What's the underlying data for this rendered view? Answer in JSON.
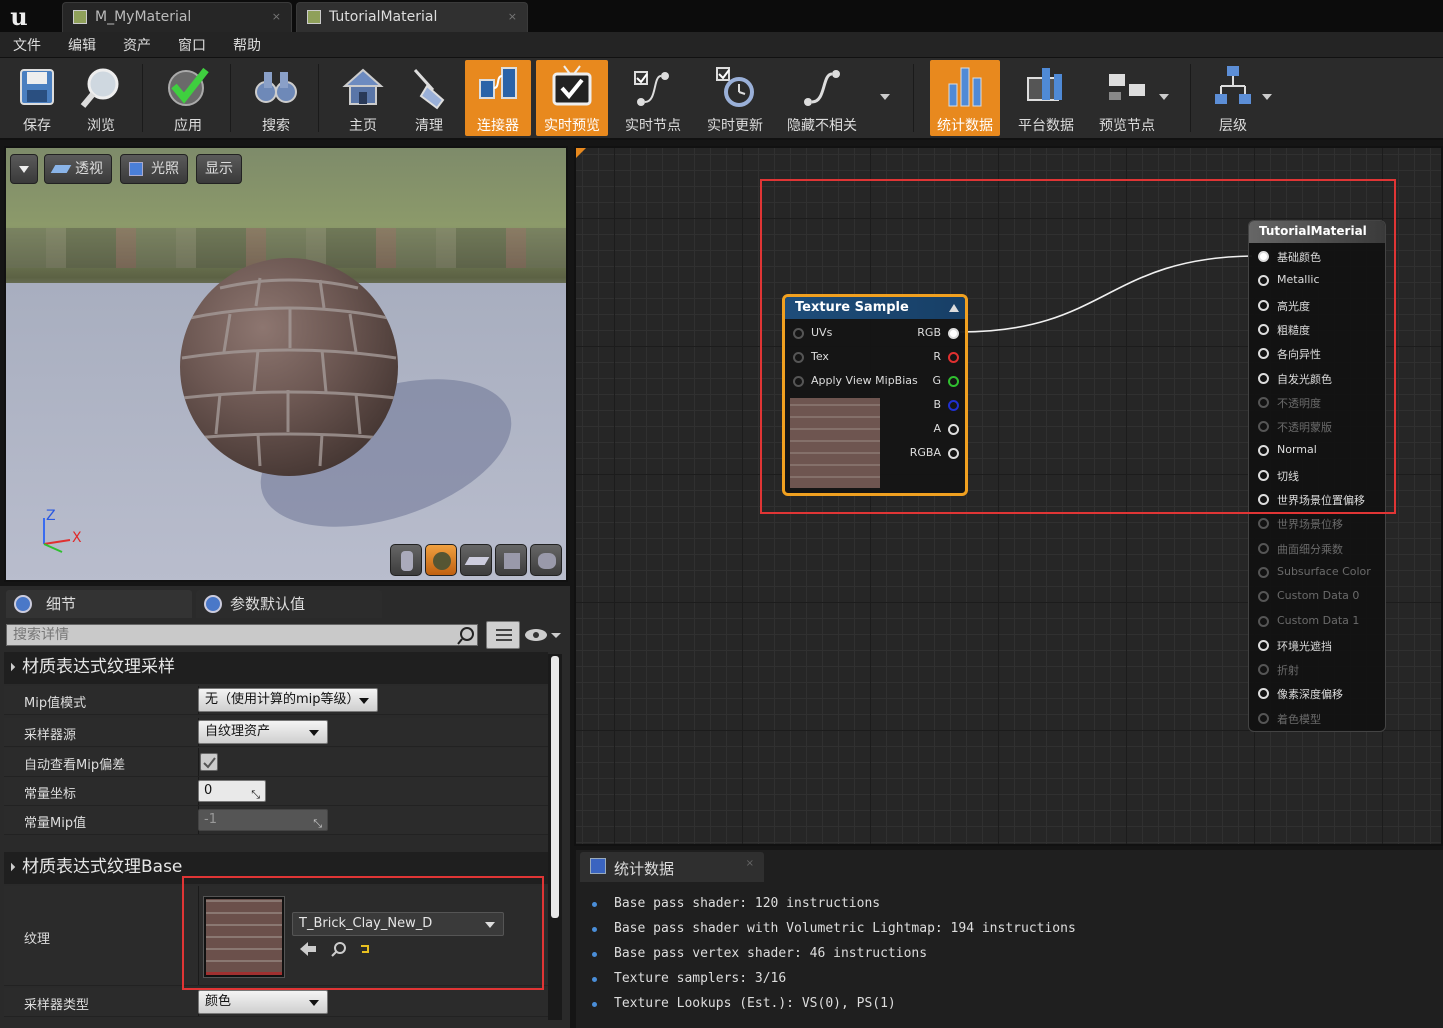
{
  "tabs": [
    {
      "label": "M_MyMaterial",
      "close": "×"
    },
    {
      "label": "TutorialMaterial",
      "close": "×"
    }
  ],
  "menu": [
    "文件",
    "编辑",
    "资产",
    "窗口",
    "帮助"
  ],
  "toolbar": {
    "save": "保存",
    "browse": "浏览",
    "apply": "应用",
    "search": "搜索",
    "home": "主页",
    "clean": "清理",
    "connectors": "连接器",
    "live_preview": "实时预览",
    "live_nodes": "实时节点",
    "live_update": "实时更新",
    "hide_unrelated": "隐藏不相关",
    "stats": "统计数据",
    "platform_stats": "平台数据",
    "preview_nodes": "预览节点",
    "hierarchy": "层级"
  },
  "viewport": {
    "perspective": "透视",
    "lit": "光照",
    "show": "显示",
    "axis_z": "Z",
    "axis_x": "X"
  },
  "details": {
    "tab_details": "细节",
    "tab_params": "参数默认值",
    "search_placeholder": "搜索详情",
    "cat1": "材质表达式纹理采样",
    "mip_mode_label": "Mip值模式",
    "mip_mode_value": "无（使用计算的mip等级）",
    "sampler_source_label": "采样器源",
    "sampler_source_value": "自纹理资产",
    "auto_mip_label": "自动查看Mip偏差",
    "const_coord_label": "常量坐标",
    "const_coord_value": "0",
    "const_mip_label": "常量Mip值",
    "const_mip_value": "-1",
    "cat2": "材质表达式纹理Base",
    "texture_label": "纹理",
    "texture_value": "T_Brick_Clay_New_D",
    "sampler_type_label": "采样器类型",
    "sampler_type_value": "颜色"
  },
  "texture_node": {
    "title": "Texture Sample",
    "inputs": [
      "UVs",
      "Tex",
      "Apply View MipBias"
    ],
    "outputs": [
      "RGB",
      "R",
      "G",
      "B",
      "A",
      "RGBA"
    ]
  },
  "material_node": {
    "title": "TutorialMaterial",
    "pins": [
      {
        "label": "基础颜色",
        "enabled": true
      },
      {
        "label": "Metallic",
        "enabled": true
      },
      {
        "label": "高光度",
        "enabled": true
      },
      {
        "label": "粗糙度",
        "enabled": true
      },
      {
        "label": "各向异性",
        "enabled": true
      },
      {
        "label": "自发光颜色",
        "enabled": true
      },
      {
        "label": "不透明度",
        "enabled": false
      },
      {
        "label": "不透明蒙版",
        "enabled": false
      },
      {
        "label": "Normal",
        "enabled": true
      },
      {
        "label": "切线",
        "enabled": true
      },
      {
        "label": "世界场景位置偏移",
        "enabled": true
      },
      {
        "label": "世界场景位移",
        "enabled": false
      },
      {
        "label": "曲面细分乘数",
        "enabled": false
      },
      {
        "label": "Subsurface Color",
        "enabled": false
      },
      {
        "label": "Custom Data 0",
        "enabled": false
      },
      {
        "label": "Custom Data 1",
        "enabled": false
      },
      {
        "label": "环境光遮挡",
        "enabled": true
      },
      {
        "label": "折射",
        "enabled": false
      },
      {
        "label": "像素深度偏移",
        "enabled": true
      },
      {
        "label": "着色模型",
        "enabled": false
      }
    ]
  },
  "stats": {
    "tab": "统计数据",
    "lines": [
      "Base pass shader: 120 instructions",
      "Base pass shader with Volumetric Lightmap: 194 instructions",
      "Base pass vertex shader: 46 instructions",
      "Texture samplers: 3/16",
      "Texture Lookups (Est.): VS(0), PS(1)"
    ]
  },
  "colors": {
    "highlight": "#e8891e",
    "annotation": "#e03535",
    "node_header": "#1e4d7a"
  }
}
